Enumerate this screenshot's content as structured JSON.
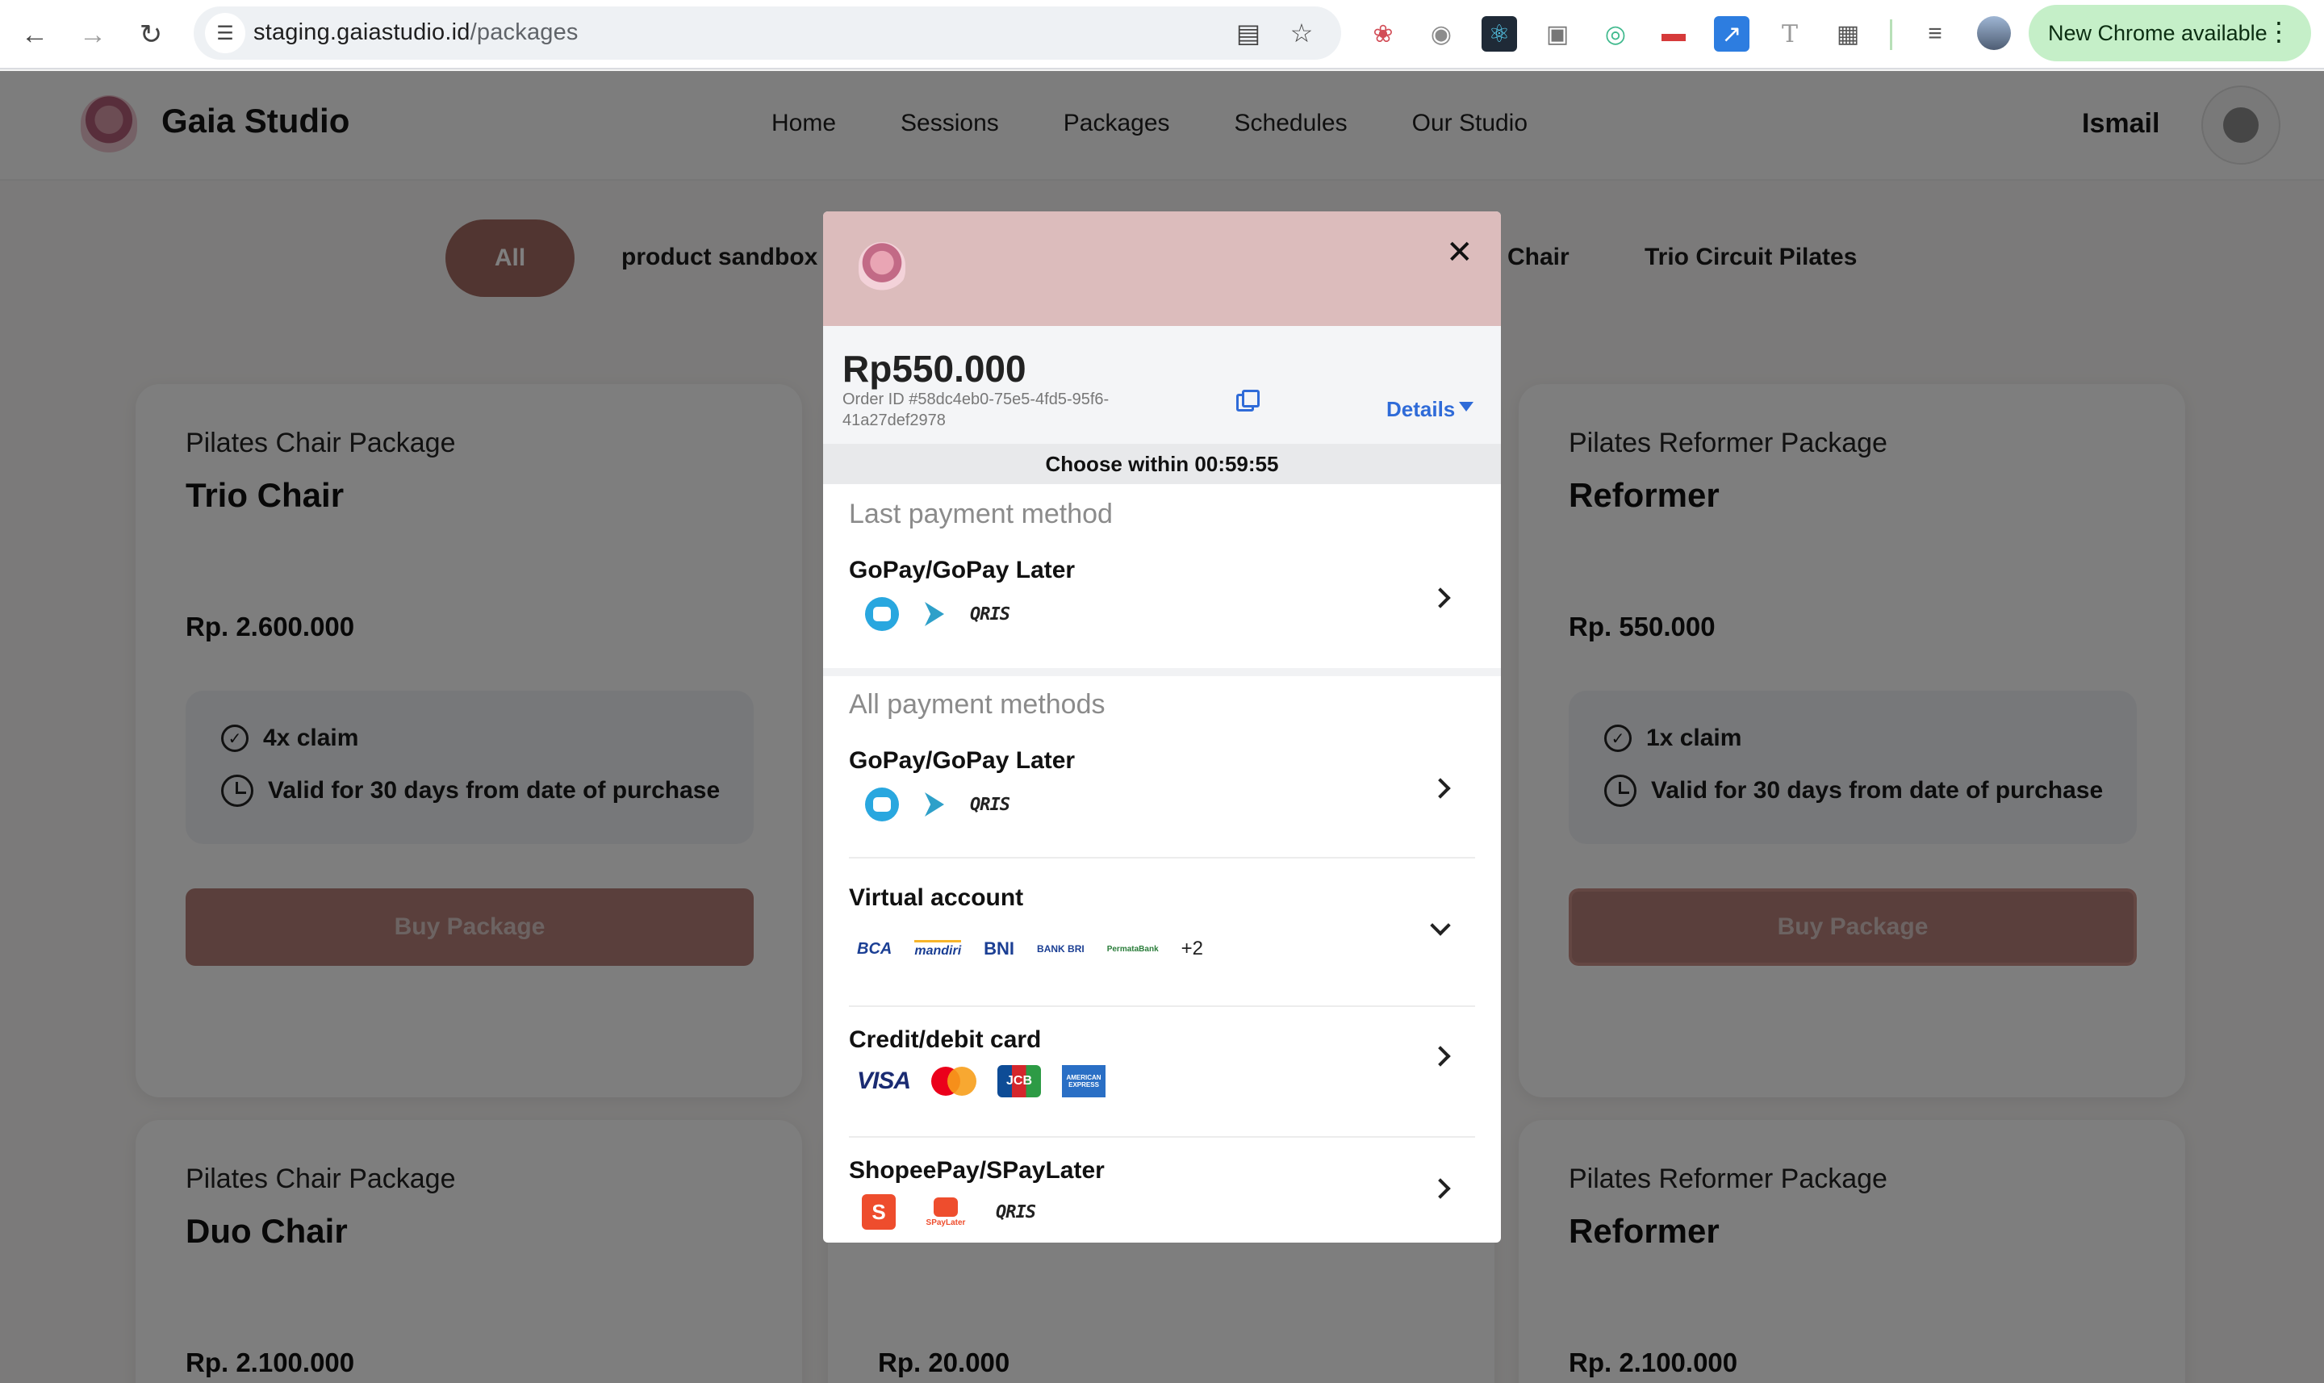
{
  "browser": {
    "url_host": "staging.gaiastudio.id",
    "url_path": "/packages",
    "update_label": "New Chrome available"
  },
  "header": {
    "brand": "Gaia Studio",
    "nav": [
      "Home",
      "Sessions",
      "Packages",
      "Schedules",
      "Our Studio"
    ],
    "user": "Ismail"
  },
  "filters": {
    "active": "All",
    "items": [
      "product sandbox",
      "Chair",
      "Trio Circuit Pilates"
    ]
  },
  "cards": [
    {
      "category": "Pilates Chair Package",
      "name": "Trio Chair",
      "price": "Rp. 2.600.000",
      "claim": "4x claim",
      "validity": "Valid for 30 days from date of purchase",
      "button": "Buy Package"
    },
    {
      "category": "Pilates Reformer Package",
      "name": "Reformer",
      "price": "Rp. 550.000",
      "claim": "1x claim",
      "validity": "Valid for 30 days from date of purchase",
      "button": "Buy Package"
    },
    {
      "category": "Pilates Chair Package",
      "name": "Duo Chair",
      "price": "Rp. 2.100.000"
    },
    {
      "price": "Rp. 20.000"
    },
    {
      "category": "Pilates Reformer Package",
      "name": "Reformer",
      "price": "Rp. 2.100.000"
    }
  ],
  "payment": {
    "amount": "Rp550.000",
    "order_id": "Order ID #58dc4eb0-75e5-4fd5-95f6-41a27def2978",
    "details_label": "Details",
    "timer": "Choose within 00:59:55",
    "last_title": "Last payment method",
    "all_title": "All payment methods",
    "methods": {
      "last_gopay": "GoPay/GoPay Later",
      "gopay": "GoPay/GoPay Later",
      "va": "Virtual account",
      "va_more": "+2",
      "card": "Credit/debit card",
      "shopee": "ShopeePay/SPayLater"
    },
    "logos": {
      "qris": "QRIS",
      "bca": "BCA",
      "mandiri": "mandiri",
      "bni": "BNI",
      "bri": "BANK BRI",
      "permata": "PermataBank",
      "visa": "VISA",
      "jcb": "JCB",
      "amex": "AMERICAN EXPRESS",
      "shopee": "S",
      "spaylater": "SPayLater"
    }
  }
}
